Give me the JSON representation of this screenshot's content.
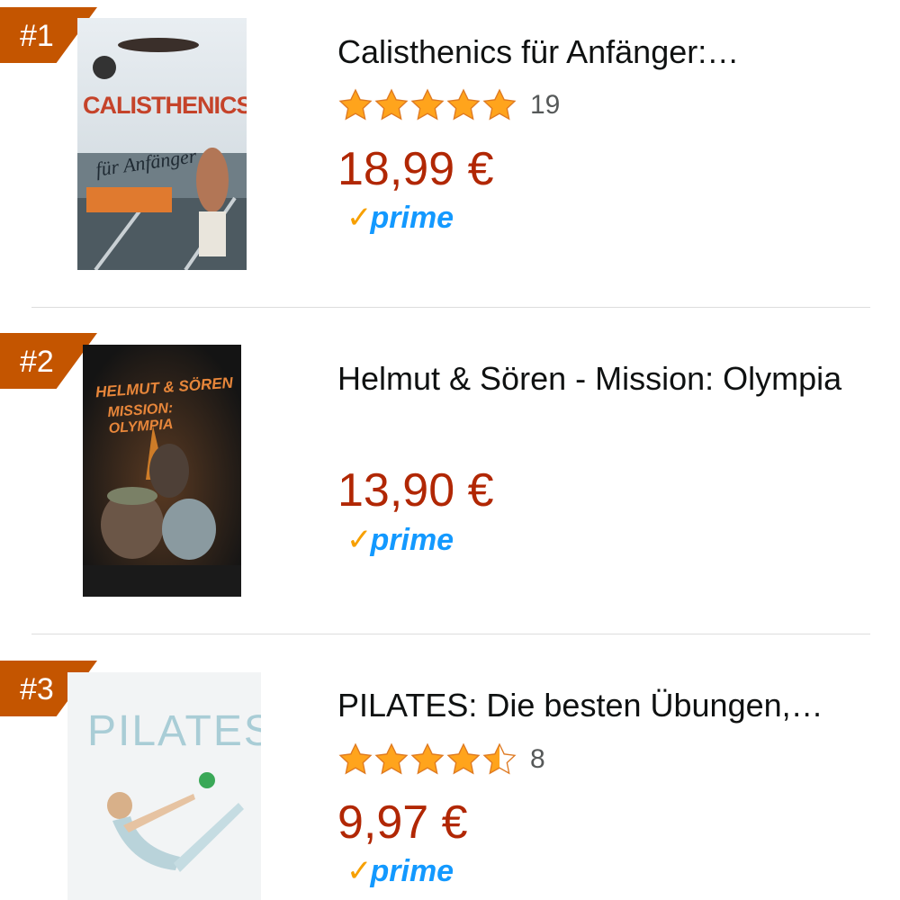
{
  "products": [
    {
      "rank": "#1",
      "title": "Calisthenics für Anfänger:…",
      "rating": 5,
      "review_count": "19",
      "price": "18,99 €",
      "prime": "prime",
      "cover": {
        "title": "CALISTHENICS",
        "subtitle": "für Anfänger"
      }
    },
    {
      "rank": "#2",
      "title": "Helmut & Sören - Mission: Olympia",
      "price": "13,90 €",
      "prime": "prime",
      "cover": {
        "title": "HELMUT & SÖREN",
        "subtitle": "MISSION: OLYMPIA"
      }
    },
    {
      "rank": "#3",
      "title": "PILATES: Die besten Übungen,…",
      "rating": 4.5,
      "review_count": "8",
      "price": "9,97 €",
      "prime": "prime",
      "cover": {
        "title": "PILATES"
      }
    }
  ],
  "colors": {
    "rank_badge": "#c45500",
    "price": "#b12704",
    "star": "#ffa41c",
    "prime_check": "#f7a000",
    "prime_text": "#1399ff"
  },
  "icons": [
    "star-icon",
    "half-star-icon",
    "prime-check-icon"
  ]
}
